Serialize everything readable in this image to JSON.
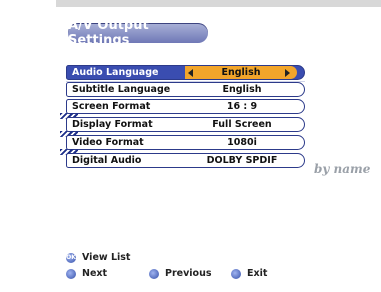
{
  "title": "A/V Output Settings",
  "menu": [
    {
      "label": "Audio Language",
      "value": "English",
      "selected": true
    },
    {
      "label": "Subtitle Language",
      "value": "English",
      "selected": false
    },
    {
      "label": "Screen Format",
      "value": "16 : 9",
      "selected": false
    },
    {
      "label": "Display Format",
      "value": "Full Screen",
      "selected": false
    },
    {
      "label": "Video Format",
      "value": "1080i",
      "selected": false
    },
    {
      "label": "Digital Audio",
      "value": "DOLBY SPDIF",
      "selected": false
    }
  ],
  "watermark": "by name",
  "hints": {
    "ok_label": "OK",
    "view_list": "View List",
    "next": "Next",
    "previous": "Previous",
    "exit": "Exit"
  },
  "colors": {
    "selected_row": "#3a4db0",
    "selected_value": "#f2a52a",
    "title_pill": "#6f78b6"
  }
}
